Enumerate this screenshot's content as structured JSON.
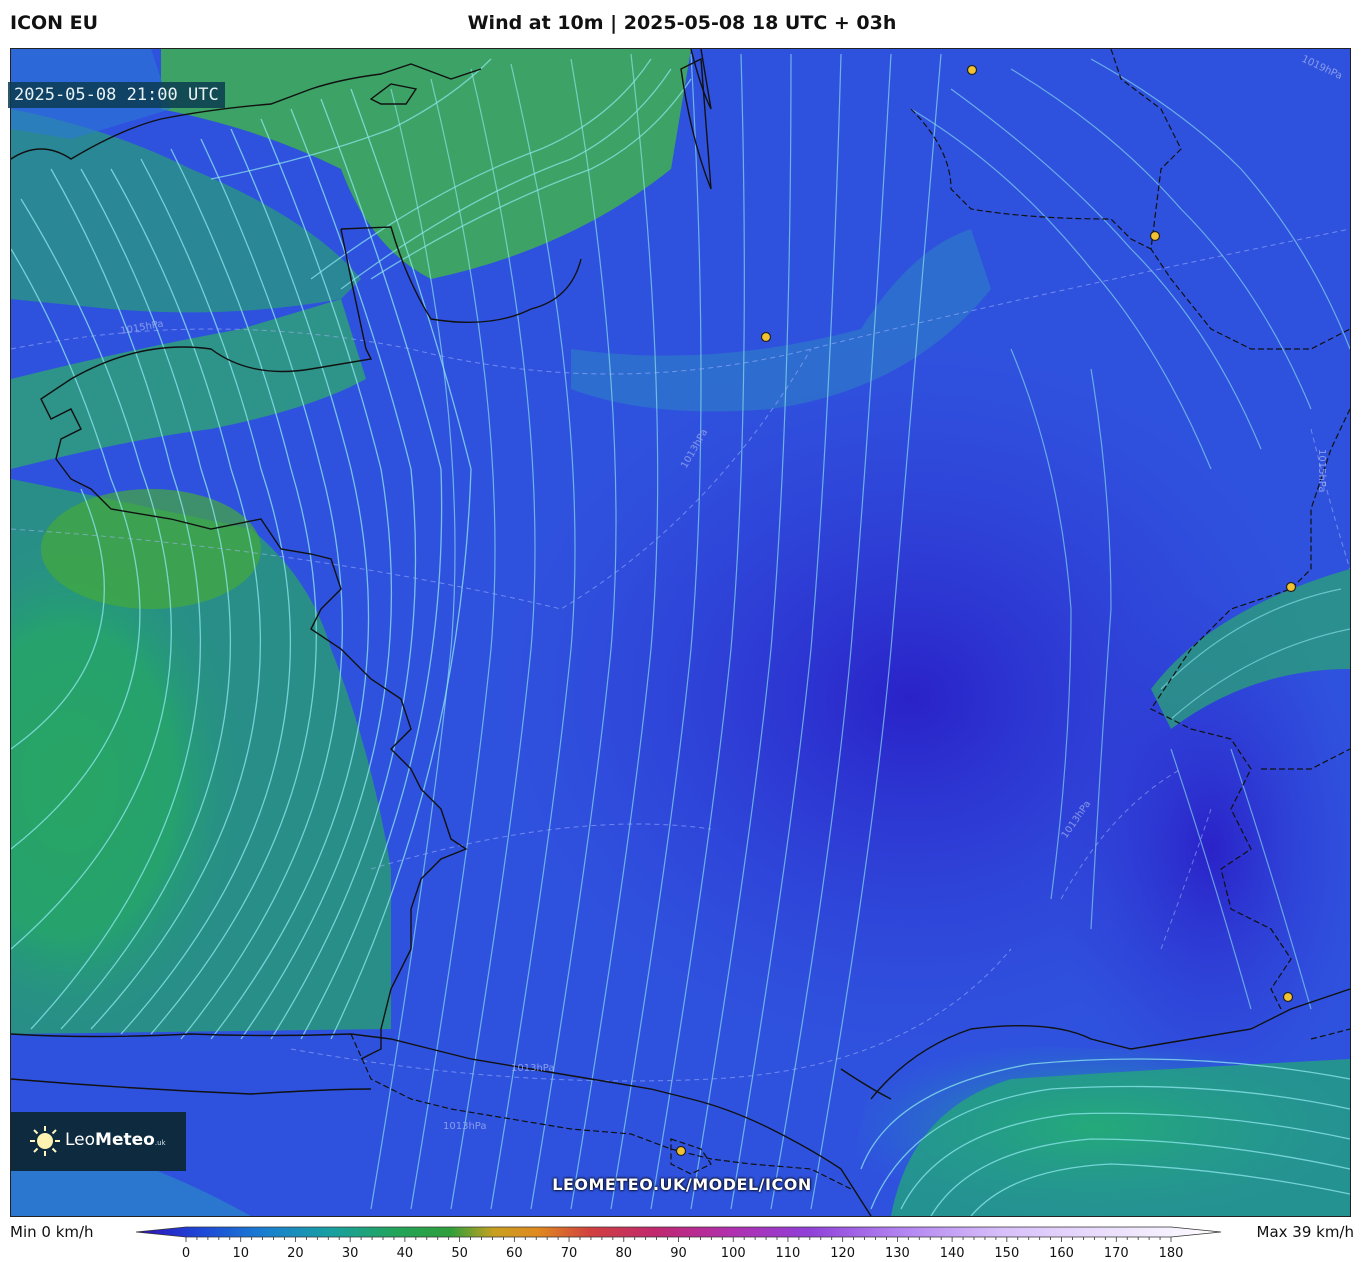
{
  "header": {
    "model": "ICON EU",
    "title": "Wind at 10m | 2025-05-08 18 UTC + 03h"
  },
  "map": {
    "valid_time": "2025-05-08 21:00 UTC",
    "watermark": "LEOMETEO.UK/MODEL/ICON",
    "isobar_labels": [
      "1019hPa",
      "1015hPa",
      "1013hPa",
      "1013hPa",
      "1013hPa",
      "1015hPa",
      "1013hPa"
    ],
    "cities": [
      "city-1",
      "city-2",
      "city-3",
      "city-4",
      "city-5",
      "city-6"
    ]
  },
  "logo": {
    "brand_light": "Leo",
    "brand_bold": "Meteo",
    "brand_suffix": ".uk"
  },
  "legend": {
    "min_label": "Min 0 km/h",
    "max_label": "Max 39 km/h",
    "unit": "km/h",
    "ticks": [
      "0",
      "10",
      "20",
      "30",
      "40",
      "50",
      "60",
      "70",
      "80",
      "90",
      "100",
      "110",
      "120",
      "130",
      "140",
      "150",
      "160",
      "170",
      "180"
    ],
    "colors": {
      "low": "#2a1fc4",
      "mid": "#1fa06a",
      "high": "#f6f0ff",
      "land_blue": "#2e4fe0",
      "sea_green": "#2fae6a",
      "streamline": "#8fe8f0"
    }
  }
}
